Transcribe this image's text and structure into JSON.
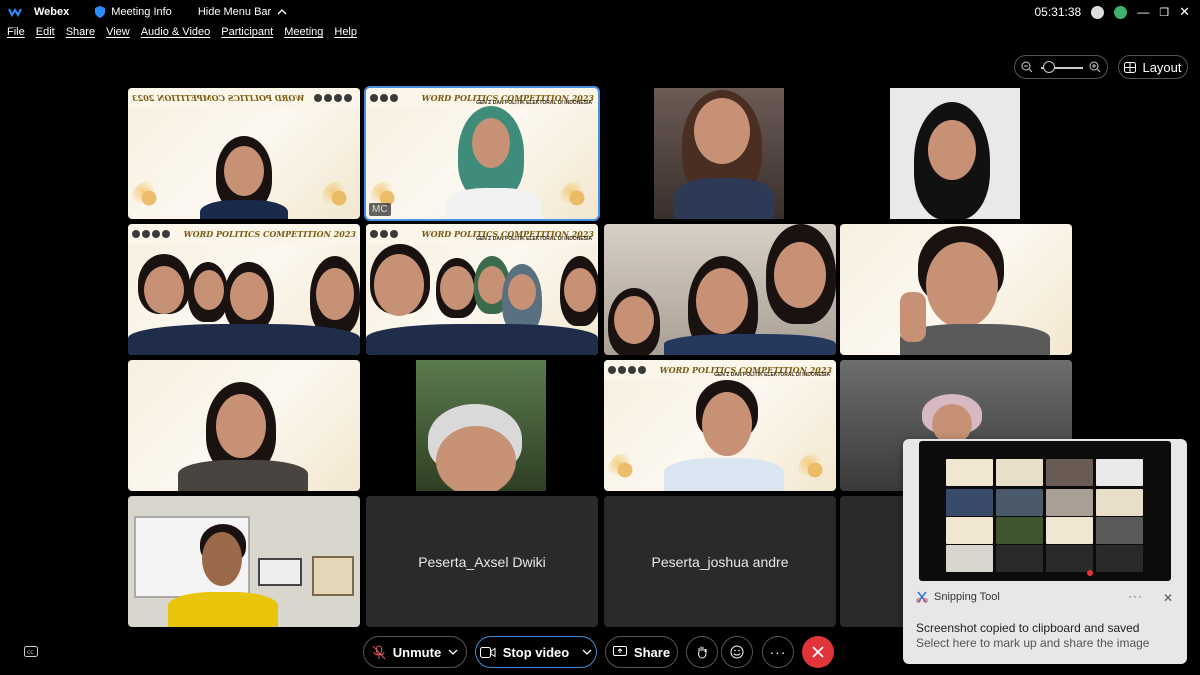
{
  "titlebar": {
    "app_name": "Webex",
    "meeting_info": "Meeting Info",
    "hide_menu": "Hide Menu Bar",
    "time": "05:31:38"
  },
  "menu": [
    "File",
    "Edit",
    "Share",
    "View",
    "Audio & Video",
    "Participant",
    "Meeting",
    "Help"
  ],
  "layout_button": "Layout",
  "tiles": {
    "mc_label": "MC",
    "banner_title": "WORD POLITICS COMPETITION 2023",
    "banner_sub": "GEN Z DAN POLITIK ELEKTORAL DI INDONESIA",
    "peserta_axsel": "Peserta_Axsel Dwiki",
    "peserta_joshua": "Peserta_joshua andre"
  },
  "controls": {
    "unmute": "Unmute",
    "stop_video": "Stop video",
    "share": "Share"
  },
  "toast": {
    "app": "Snipping Tool",
    "message": "Screenshot copied to clipboard and saved",
    "sub": "Select here to mark up and share the image"
  },
  "colors": {
    "accent_blue": "#4a90e2",
    "end_red": "#e0353b",
    "bg": "#000000"
  }
}
